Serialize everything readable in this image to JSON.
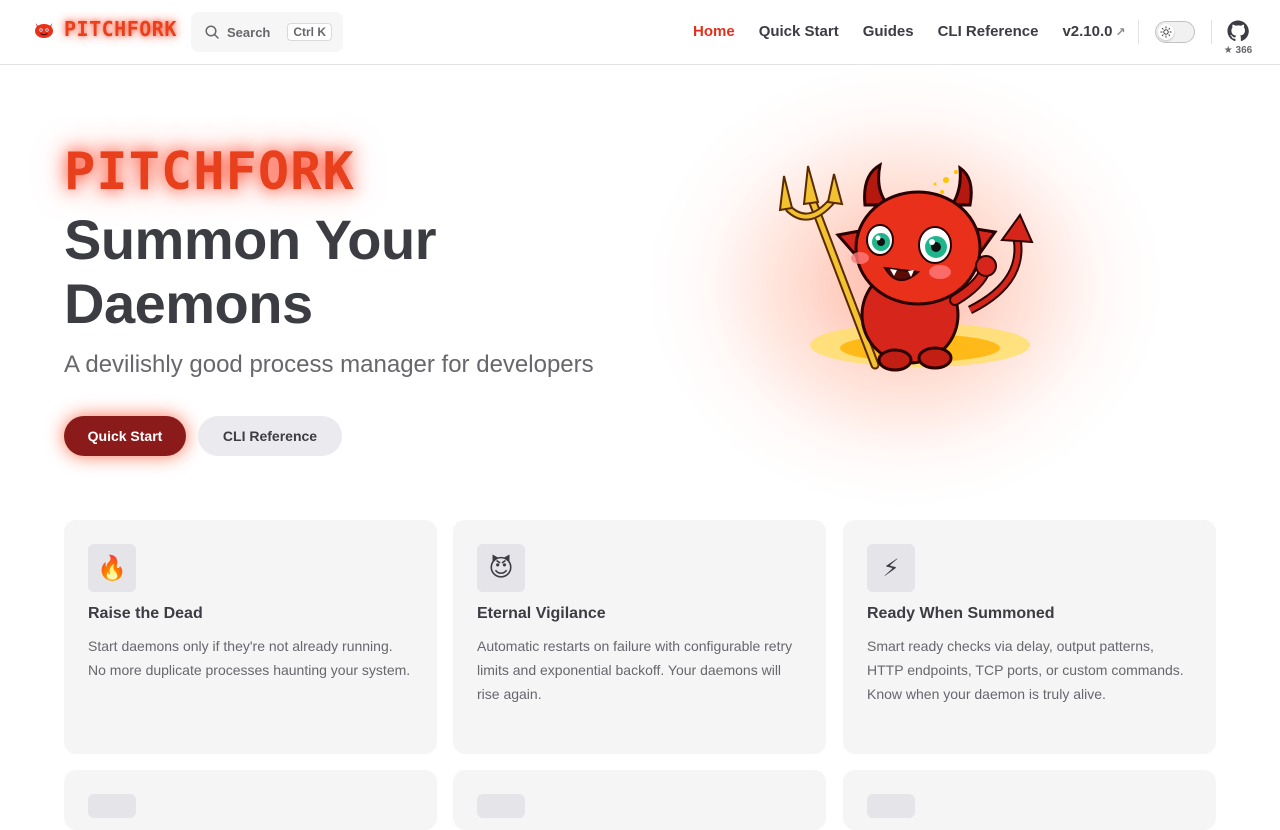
{
  "brand": {
    "name": "PITCHFORK"
  },
  "search": {
    "label": "Search",
    "shortcut": "Ctrl K"
  },
  "nav": {
    "items": [
      {
        "label": "Home",
        "active": true
      },
      {
        "label": "Quick Start"
      },
      {
        "label": "Guides"
      },
      {
        "label": "CLI Reference"
      },
      {
        "label": "v2.10.0",
        "external": true
      }
    ],
    "external_icon": "↗"
  },
  "github": {
    "stars": "★ 366",
    "icon": "github-icon"
  },
  "hero": {
    "name": "PITCHFORK",
    "title": "Summon Your Daemons",
    "tagline": "A devilishly good process manager for developers",
    "primary_button": "Quick Start",
    "secondary_button": "CLI Reference"
  },
  "features": [
    {
      "icon": "🔥",
      "title": "Raise the Dead",
      "body": "Start daemons only if they're not already running. No more duplicate processes haunting your system."
    },
    {
      "icon": "😈",
      "title": "Eternal Vigilance",
      "body": "Automatic restarts on failure with configurable retry limits and exponential backoff. Your daemons will rise again."
    },
    {
      "icon": "⚡",
      "title": "Ready When Summoned",
      "body": "Smart ready checks via delay, output patterns, HTTP endpoints, TCP ports, or custom commands. Know when your daemon is truly alive."
    }
  ],
  "colors": {
    "accent": "#e0311e",
    "primary_button": "#8b1a1a",
    "card_bg": "#f5f5f6"
  }
}
